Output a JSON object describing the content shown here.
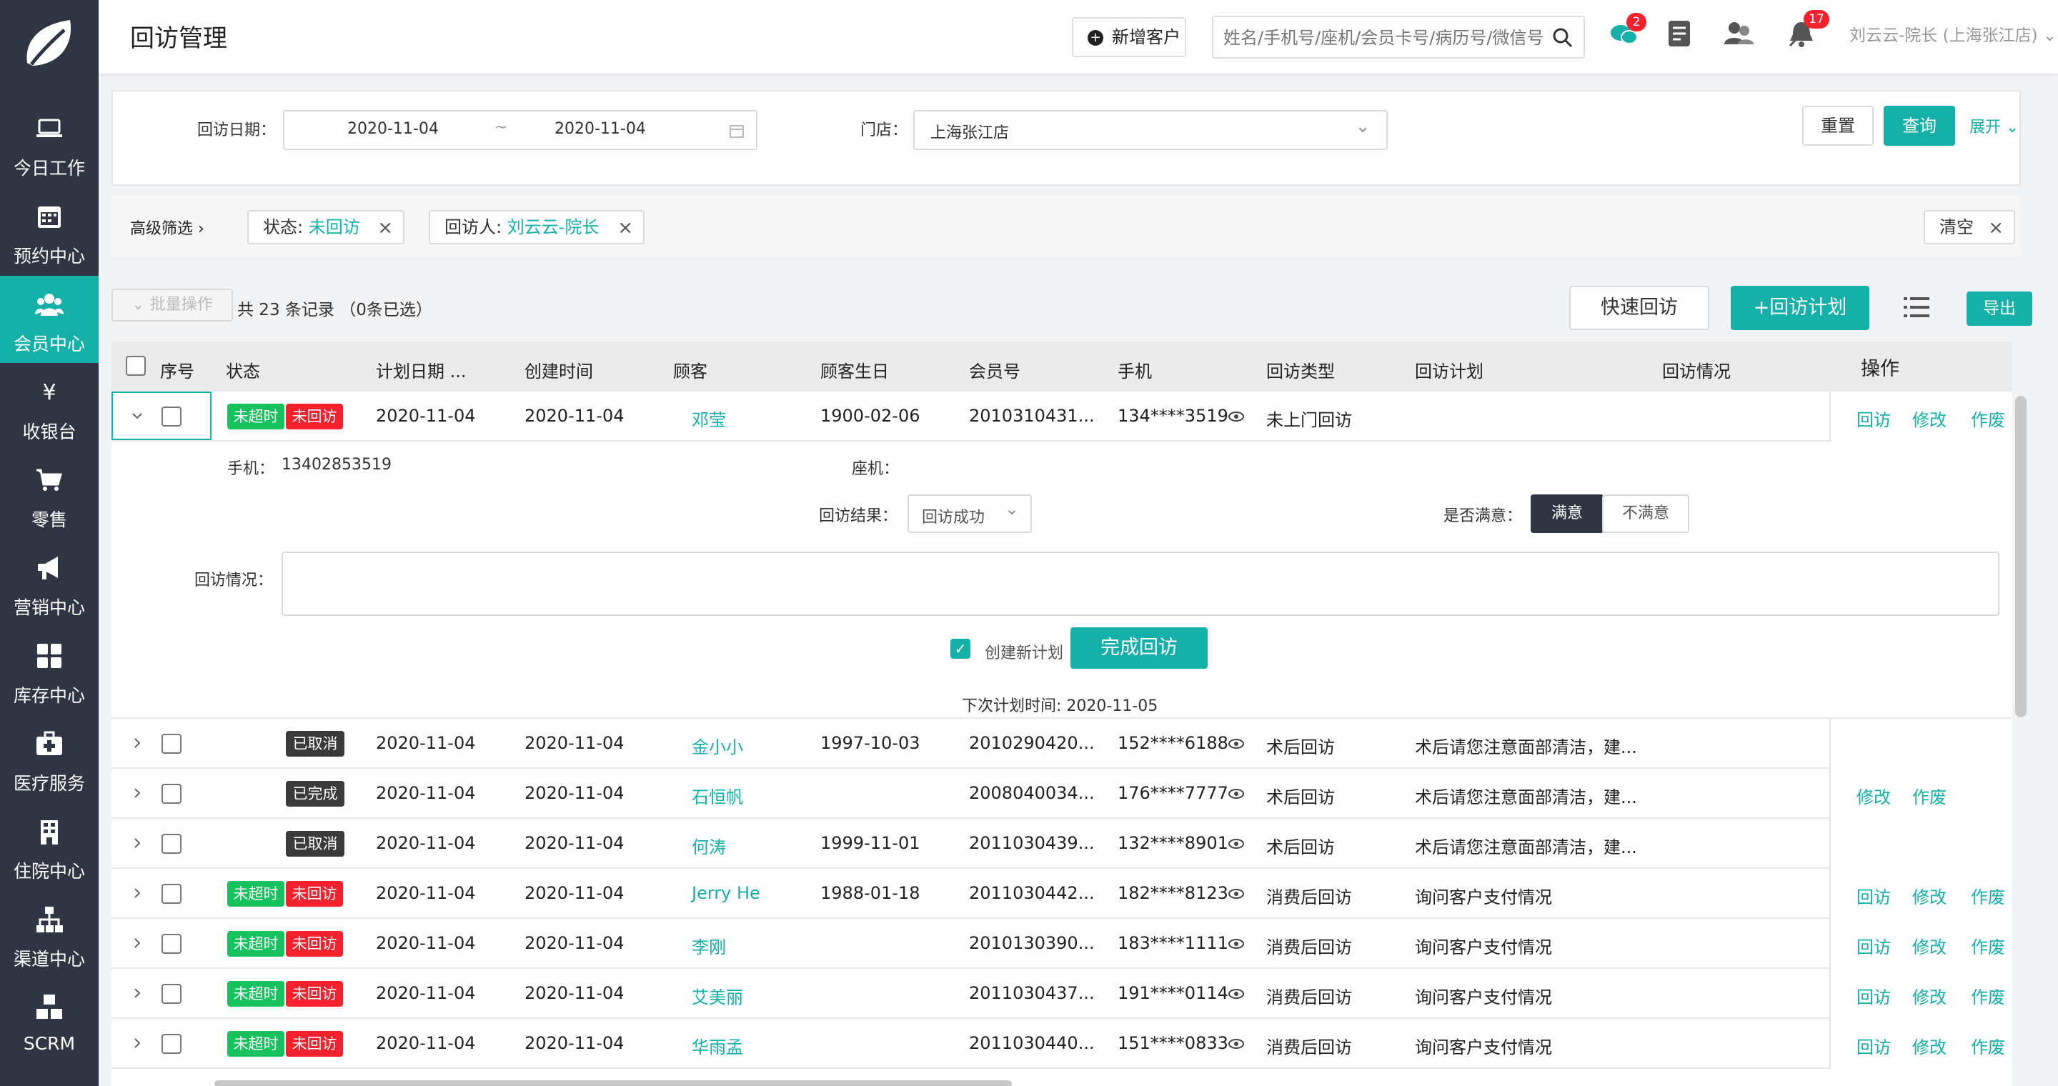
{
  "sidebar": {
    "items": [
      {
        "label": "今日工作",
        "icon": "laptop-icon"
      },
      {
        "label": "预约中心",
        "icon": "calendar-icon"
      },
      {
        "label": "会员中心",
        "icon": "members-icon",
        "active": true
      },
      {
        "label": "收银台",
        "icon": "yen-icon"
      },
      {
        "label": "零售",
        "icon": "cart-icon"
      },
      {
        "label": "营销中心",
        "icon": "megaphone-icon"
      },
      {
        "label": "库存中心",
        "icon": "grid-icon"
      },
      {
        "label": "医疗服务",
        "icon": "medical-kit-icon"
      },
      {
        "label": "住院中心",
        "icon": "building-icon"
      },
      {
        "label": "渠道中心",
        "icon": "org-chart-icon"
      },
      {
        "label": "SCRM",
        "icon": "cubes-icon"
      }
    ]
  },
  "header": {
    "title": "回访管理",
    "add_customer": "新增客户",
    "search_placeholder": "姓名/手机号/座机/会员卡号/病历号/微信号",
    "wechat_badge": "2",
    "notify_badge": "17",
    "user": "刘云云-院长 (上海张江店)"
  },
  "filter": {
    "date_label": "回访日期：",
    "date_start": "2020-11-04",
    "date_sep": "~",
    "date_end": "2020-11-04",
    "store_label": "门店：",
    "store_value": "上海张江店",
    "reset": "重置",
    "query": "查询",
    "expand": "展开"
  },
  "advanced": {
    "label": "高级筛选",
    "tag1_key": "状态: ",
    "tag1_val": "未回访",
    "tag2_key": "回访人: ",
    "tag2_val": "刘云云-院长",
    "clear": "清空"
  },
  "toolbar": {
    "batch": "批量操作",
    "count": "共 23 条记录",
    "selected": "（0条已选）",
    "quick": "快速回访",
    "plan": "+回访计划",
    "export": "导出"
  },
  "columns": [
    "序号",
    "状态",
    "计划日期 ...",
    "创建时间",
    "顾客",
    "顾客生日",
    "会员号",
    "手机",
    "回访类型",
    "回访计划",
    "回访情况",
    "操作"
  ],
  "status": {
    "not_overdue": "未超时",
    "not_visited": "未回访",
    "cancelled": "已取消",
    "done": "已完成"
  },
  "ops": {
    "visit": "回访",
    "edit": "修改",
    "void": "作废"
  },
  "rows": [
    {
      "plan_date": "2020-11-04",
      "created": "2020-11-04",
      "customer": "邓莹",
      "birthday": "1900-02-06",
      "member": "2010310431...",
      "phone": "134****3519",
      "type": "未上门回访",
      "plan": "",
      "status": [
        "not_overdue",
        "not_visited"
      ],
      "ops": [
        "visit",
        "edit",
        "void"
      ]
    },
    {
      "plan_date": "2020-11-04",
      "created": "2020-11-04",
      "customer": "金小小",
      "birthday": "1997-10-03",
      "member": "2010290420...",
      "phone": "152****6188",
      "type": "术后回访",
      "plan": "术后请您注意面部清洁，建...",
      "status": [
        "cancelled"
      ],
      "ops": []
    },
    {
      "plan_date": "2020-11-04",
      "created": "2020-11-04",
      "customer": "石恒帆",
      "birthday": "",
      "member": "2008040034...",
      "phone": "176****7777",
      "type": "术后回访",
      "plan": "术后请您注意面部清洁，建...",
      "status": [
        "done"
      ],
      "ops": [
        "edit",
        "void"
      ]
    },
    {
      "plan_date": "2020-11-04",
      "created": "2020-11-04",
      "customer": "何涛",
      "birthday": "1999-11-01",
      "member": "2011030439...",
      "phone": "132****8901",
      "type": "术后回访",
      "plan": "术后请您注意面部清洁，建...",
      "status": [
        "cancelled"
      ],
      "ops": []
    },
    {
      "plan_date": "2020-11-04",
      "created": "2020-11-04",
      "customer": "Jerry He",
      "birthday": "1988-01-18",
      "member": "2011030442...",
      "phone": "182****8123",
      "type": "消费后回访",
      "plan": "询问客户支付情况",
      "status": [
        "not_overdue",
        "not_visited"
      ],
      "ops": [
        "visit",
        "edit",
        "void"
      ]
    },
    {
      "plan_date": "2020-11-04",
      "created": "2020-11-04",
      "customer": "李刚",
      "birthday": "",
      "member": "2010130390...",
      "phone": "183****1111",
      "type": "消费后回访",
      "plan": "询问客户支付情况",
      "status": [
        "not_overdue",
        "not_visited"
      ],
      "ops": [
        "visit",
        "edit",
        "void"
      ]
    },
    {
      "plan_date": "2020-11-04",
      "created": "2020-11-04",
      "customer": "艾美丽",
      "birthday": "",
      "member": "2011030437...",
      "phone": "191****0114",
      "type": "消费后回访",
      "plan": "询问客户支付情况",
      "status": [
        "not_overdue",
        "not_visited"
      ],
      "ops": [
        "visit",
        "edit",
        "void"
      ]
    },
    {
      "plan_date": "2020-11-04",
      "created": "2020-11-04",
      "customer": "华雨孟",
      "birthday": "",
      "member": "2011030440...",
      "phone": "151****0833",
      "type": "消费后回访",
      "plan": "询问客户支付情况",
      "status": [
        "not_overdue",
        "not_visited"
      ],
      "ops": [
        "visit",
        "edit",
        "void"
      ]
    }
  ],
  "detail": {
    "phone_label": "手机：",
    "phone": "13402853519",
    "landline_label": "座机：",
    "result_label": "回访结果：",
    "result_value": "回访成功",
    "satisfied_label": "是否满意：",
    "satisfied_yes": "满意",
    "satisfied_no": "不满意",
    "situation_label": "回访情况：",
    "create_plan": "创建新计划",
    "complete": "完成回访",
    "next_time": "下次计划时间: 2020-11-05"
  },
  "colors": {
    "accent": "#15b0a7",
    "sidebar": "#2f3542",
    "red": "#f5222d",
    "green": "#16c25d"
  }
}
